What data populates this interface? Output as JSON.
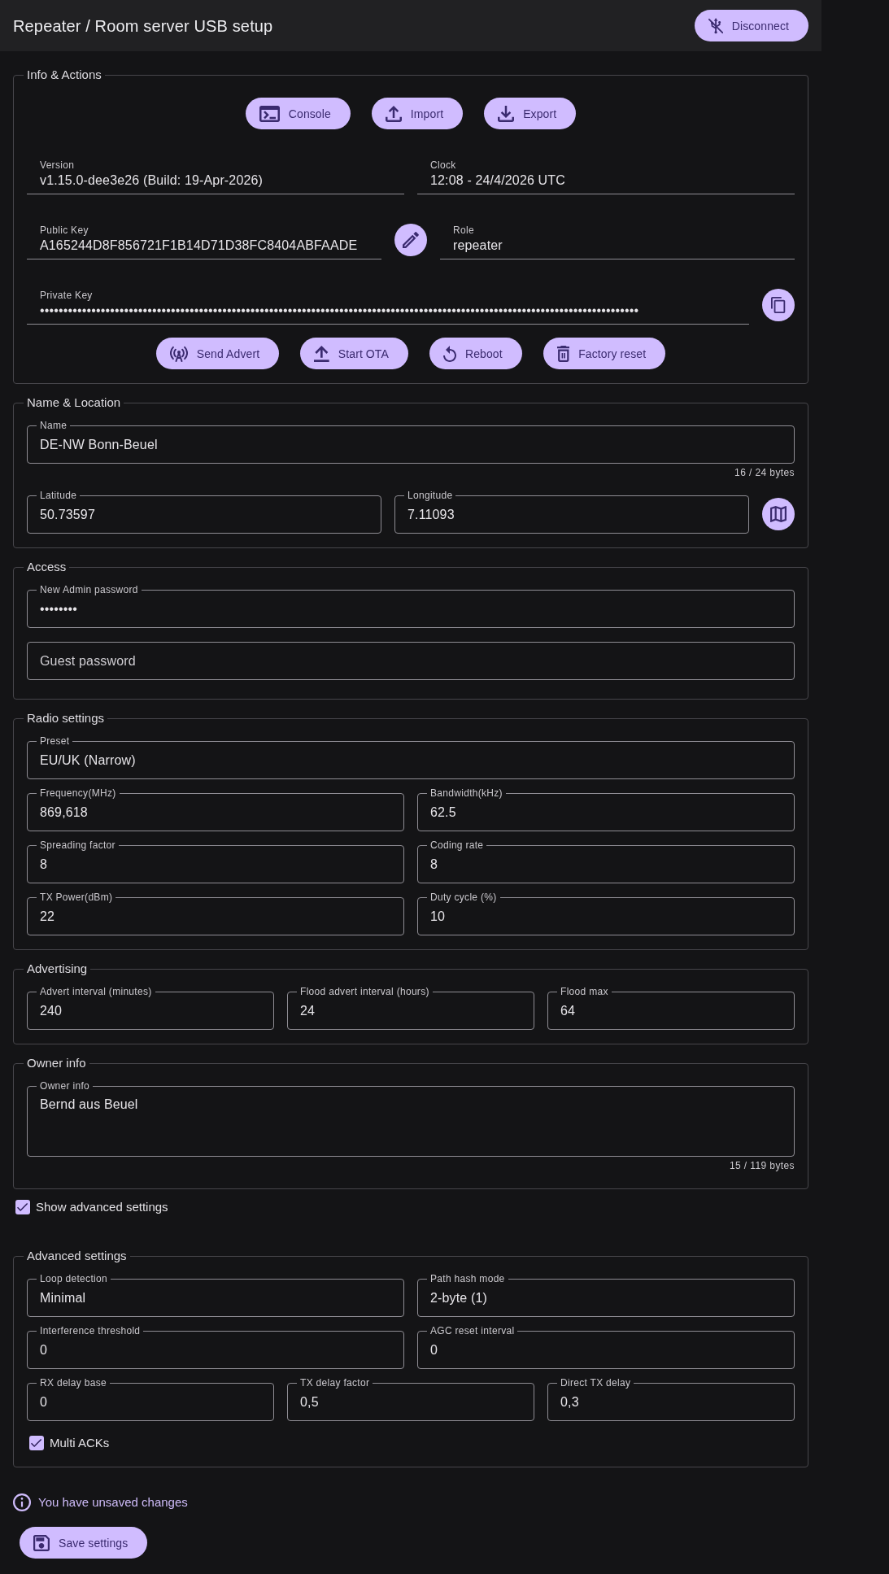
{
  "header": {
    "title": "Repeater / Room server USB setup",
    "button": {
      "kind": "disconnect",
      "label": "Disconnect"
    }
  },
  "sections": [
    {
      "legend": "Info & Actions",
      "rows": [
        {
          "kind": "buttons",
          "items": [
            {
              "kind": "console",
              "label": "Console"
            },
            {
              "kind": "import",
              "label": "Import"
            },
            {
              "kind": "export",
              "label": "Export"
            }
          ]
        },
        {
          "kind": "fields",
          "items": [
            {
              "kind": "readonly",
              "label": "Version",
              "value": "v1.15.0-dee3e26 (Build: 19-Apr-2026)"
            },
            {
              "kind": "readonly",
              "label": "Clock",
              "value": "12:08 - 24/4/2026 UTC"
            }
          ]
        },
        {
          "kind": "fields",
          "items": [
            {
              "kind": "readonly",
              "label": "Public Key",
              "value": "A165244D8F856721F1B14D71D38FC8404ABFAADE"
            },
            {
              "kind": "edit"
            },
            {
              "kind": "readonly",
              "label": "Role",
              "value": "repeater"
            }
          ]
        },
        {
          "kind": "fields",
          "items": [
            {
              "kind": "readonly",
              "label": "Private Key",
              "value": "••••••••••••••••••••••••••••••••••••••••••••••••••••••••••••••••••••••••••••••••••••••••••••••••••••••••••••••••••••••••••••••••"
            },
            {
              "kind": "copy"
            }
          ]
        },
        {
          "kind": "buttons",
          "items": [
            {
              "kind": "advert",
              "label": "Send Advert"
            },
            {
              "kind": "ota",
              "label": "Start OTA"
            },
            {
              "kind": "reboot",
              "label": "Reboot"
            },
            {
              "kind": "reset",
              "label": "Factory reset"
            }
          ]
        }
      ]
    },
    {
      "legend": "Name & Location",
      "rows": [
        {
          "kind": "fields",
          "items": [
            {
              "kind": "outlined",
              "label": "Name",
              "value": "DE-NW Bonn-Beuel",
              "counter": "16 / 24 bytes"
            }
          ]
        },
        {
          "kind": "fields",
          "items": [
            {
              "kind": "outlined",
              "label": "Latitude",
              "value": "50.73597"
            },
            {
              "kind": "outlined",
              "label": "Longitude",
              "value": "7.11093"
            },
            {
              "kind": "map"
            }
          ]
        }
      ]
    },
    {
      "legend": "Access",
      "rows": [
        {
          "kind": "fields",
          "items": [
            {
              "kind": "outlined",
              "label": "New Admin password",
              "value": "••••••••"
            }
          ]
        },
        {
          "kind": "fields",
          "items": [
            {
              "kind": "outlined",
              "placeholder": "Guest password"
            }
          ]
        }
      ]
    },
    {
      "legend": "Radio settings",
      "rows": [
        {
          "kind": "fields",
          "items": [
            {
              "kind": "outlined",
              "label": "Preset",
              "value": "EU/UK (Narrow)"
            }
          ]
        },
        {
          "kind": "fields",
          "items": [
            {
              "kind": "outlined",
              "label": "Frequency(MHz)",
              "value": "869,618"
            },
            {
              "kind": "outlined",
              "label": "Bandwidth(kHz)",
              "value": "62.5"
            }
          ]
        },
        {
          "kind": "fields",
          "items": [
            {
              "kind": "outlined",
              "label": "Spreading factor",
              "value": "8"
            },
            {
              "kind": "outlined",
              "label": "Coding rate",
              "value": "8"
            }
          ]
        },
        {
          "kind": "fields",
          "items": [
            {
              "kind": "outlined",
              "label": "TX Power(dBm)",
              "value": "22"
            },
            {
              "kind": "outlined",
              "label": "Duty cycle (%)",
              "value": "10"
            }
          ]
        }
      ]
    },
    {
      "legend": "Advertising",
      "rows": [
        {
          "kind": "fields",
          "items": [
            {
              "kind": "outlined",
              "label": "Advert interval (minutes)",
              "value": "240"
            },
            {
              "kind": "outlined",
              "label": "Flood advert interval (hours)",
              "value": "24"
            },
            {
              "kind": "outlined",
              "label": "Flood max",
              "value": "64"
            }
          ]
        }
      ]
    },
    {
      "legend": "Owner info",
      "rows": [
        {
          "kind": "fields",
          "items": [
            {
              "kind": "textarea",
              "label": "Owner info",
              "value": "Bernd aus Beuel",
              "counter": "15 / 119 bytes"
            }
          ]
        }
      ]
    }
  ],
  "show_advanced": {
    "label": "Show advanced settings",
    "checked": true
  },
  "advanced": {
    "legend": "Advanced settings",
    "rows": [
      {
        "kind": "fields",
        "items": [
          {
            "kind": "outlined",
            "label": "Loop detection",
            "value": "Minimal"
          },
          {
            "kind": "outlined",
            "label": "Path hash mode",
            "value": "2-byte (1)"
          }
        ]
      },
      {
        "kind": "fields",
        "items": [
          {
            "kind": "outlined",
            "label": "Interference threshold",
            "value": "0"
          },
          {
            "kind": "outlined",
            "label": "AGC reset interval",
            "value": "0"
          }
        ]
      },
      {
        "kind": "fields",
        "items": [
          {
            "kind": "outlined",
            "label": "RX delay base",
            "value": "0"
          },
          {
            "kind": "outlined",
            "label": "TX delay factor",
            "value": "0,5"
          },
          {
            "kind": "outlined",
            "label": "Direct TX delay",
            "value": "0,3"
          }
        ]
      },
      {
        "kind": "checkbox",
        "label": "Multi ACKs",
        "checked": true
      }
    ]
  },
  "status": {
    "message": "You have unsaved changes"
  },
  "save_button": {
    "kind": "save",
    "label": "Save settings"
  }
}
